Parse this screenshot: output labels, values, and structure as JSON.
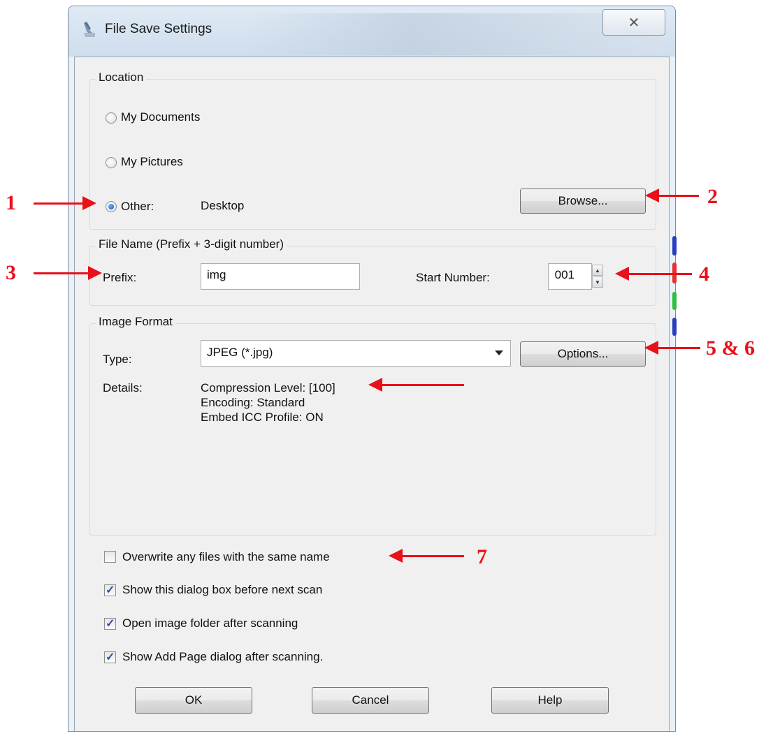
{
  "window": {
    "title": "File Save Settings",
    "close_symbol": "✕"
  },
  "location": {
    "group_label": "Location",
    "options": [
      {
        "label": "My Documents",
        "checked": false
      },
      {
        "label": "My Pictures",
        "checked": false
      },
      {
        "label": "Other:",
        "checked": true,
        "value": "Desktop"
      }
    ],
    "browse_label": "Browse..."
  },
  "file_name": {
    "group_label": "File Name (Prefix + 3-digit number)",
    "prefix_label": "Prefix:",
    "prefix_value": "img",
    "start_number_label": "Start Number:",
    "start_number_value": "001"
  },
  "image_format": {
    "group_label": "Image Format",
    "type_label": "Type:",
    "type_value": "JPEG (*.jpg)",
    "options_label": "Options...",
    "details_label": "Details:",
    "details": [
      "Compression Level: [100]",
      "Encoding: Standard",
      "Embed ICC Profile: ON"
    ]
  },
  "checkboxes": [
    {
      "label": "Overwrite any files with the same name",
      "checked": false
    },
    {
      "label": "Show this dialog box before next scan",
      "checked": true
    },
    {
      "label": "Open image folder after scanning",
      "checked": true
    },
    {
      "label": "Show Add Page dialog after scanning.",
      "checked": true
    }
  ],
  "buttons": {
    "ok": "OK",
    "cancel": "Cancel",
    "help": "Help"
  },
  "annotations": {
    "n1": "1",
    "n2": "2",
    "n3": "3",
    "n4": "4",
    "n56": "5 & 6",
    "n7": "7",
    "color": "#e8101a"
  }
}
